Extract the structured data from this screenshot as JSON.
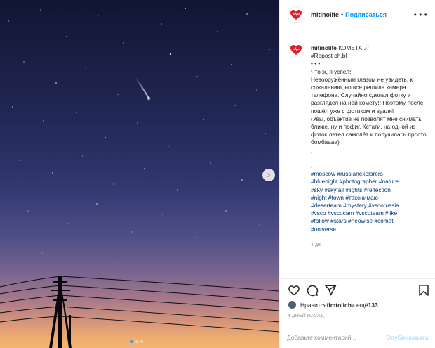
{
  "post": {
    "username": "mitinolife",
    "separator": "•",
    "follow_label": "Подписаться",
    "more_label": "•••",
    "caption_title": "КОМЕТА ☄",
    "caption_body": "#Repost ph.bl\n• • •\nЧто ж, я успел!\nНевооружённым глазом не увидеть, к сожалению, но все решила камера телефона. Случайно сделал фотку и разглядел на ней комету!! Поэтому после пошёл уже с фотиком и вуаля!\n(Увы, объектив не позволят мне снимать ближе, ну и пофиг. Кстати, на одной из фоток летел самолёт и получилась просто бомбаааа)\n.\n.\n.",
    "hashtags": "#moscow #russianexplorers\n#bluenight #photographer #nature\n#sky #skyfall #lights #reflection\n#night #town #такснимаю\n#deserteam #mystery #vscorussia\n#vsco #vscocam #vscoteam #like\n#follow #stars #neowise #comet\n#universe",
    "caption_time": "4 дн.",
    "likes_prefix": "Нравится ",
    "likes_user": "fimtolich",
    "likes_mid": " и ещё ",
    "likes_count": "133",
    "posted_ago": "4 ДНЕЙ НАЗАД",
    "comment_placeholder": "Добавьте комментарий...",
    "publish_label": "Опубликовать",
    "next_arrow": "›"
  },
  "carousel": {
    "slides": 3,
    "active_index": 0
  },
  "icons": {
    "like": "heart-icon",
    "comment": "comment-bubble-icon",
    "share": "paper-plane-icon",
    "save": "bookmark-icon"
  },
  "colors": {
    "link": "#0095f6",
    "hashtag": "#00376b",
    "muted": "#8e8e8e",
    "logo_red": "#d8232a"
  }
}
